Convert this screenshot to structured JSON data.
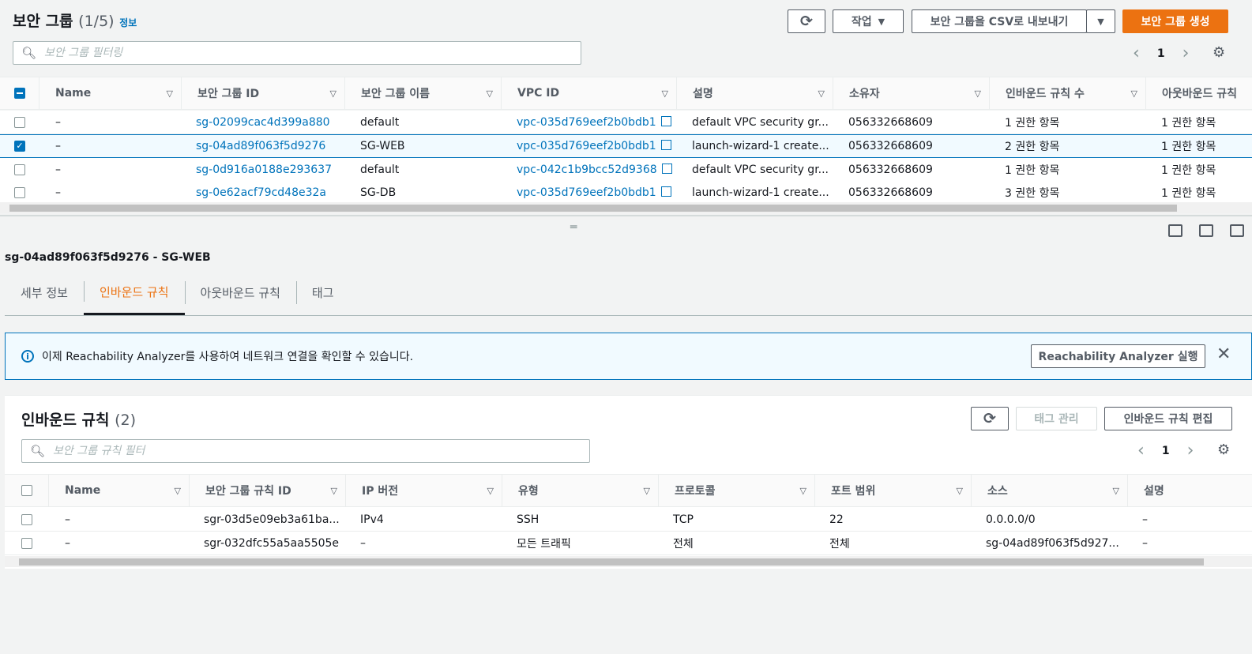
{
  "header": {
    "title": "보안 그룹",
    "count": "(1/5)",
    "info": "정보",
    "actions_label": "작업",
    "export_label": "보안 그룹을 CSV로 내보내기",
    "create_label": "보안 그룹 생성"
  },
  "search": {
    "placeholder": "보안 그룹 필터링"
  },
  "pager": {
    "page": "1"
  },
  "sg_table": {
    "columns": [
      "Name",
      "보안 그룹 ID",
      "보안 그룹 이름",
      "VPC ID",
      "설명",
      "소유자",
      "인바운드 규칙 수",
      "아웃바운드 규칙"
    ],
    "rows": [
      {
        "name": "–",
        "id": "sg-02099cac4d399a880",
        "group_name": "default",
        "vpc": "vpc-035d769eef2b0bdb1",
        "desc": "default VPC security gr...",
        "owner": "056332668609",
        "inbound": "1 권한 항목",
        "outbound": "1 권한 항목",
        "selected": false
      },
      {
        "name": "–",
        "id": "sg-04ad89f063f5d9276",
        "group_name": "SG-WEB",
        "vpc": "vpc-035d769eef2b0bdb1",
        "desc": "launch-wizard-1 create...",
        "owner": "056332668609",
        "inbound": "2 권한 항목",
        "outbound": "1 권한 항목",
        "selected": true
      },
      {
        "name": "–",
        "id": "sg-0d916a0188e293637",
        "group_name": "default",
        "vpc": "vpc-042c1b9bcc52d9368",
        "desc": "default VPC security gr...",
        "owner": "056332668609",
        "inbound": "1 권한 항목",
        "outbound": "1 권한 항목",
        "selected": false
      },
      {
        "name": "–",
        "id": "sg-0e62acf79cd48e32a",
        "group_name": "SG-DB",
        "vpc": "vpc-035d769eef2b0bdb1",
        "desc": "launch-wizard-1 create...",
        "owner": "056332668609",
        "inbound": "3 권한 항목",
        "outbound": "1 권한 항목",
        "selected": false
      }
    ]
  },
  "detail": {
    "heading": "sg-04ad89f063f5d9276 - SG-WEB",
    "tabs": [
      "세부 정보",
      "인바운드 규칙",
      "아웃바운드 규칙",
      "태그"
    ],
    "alert_text": "이제 Reachability Analyzer를 사용하여 네트워크 연결을 확인할 수 있습니다.",
    "alert_button": "Reachability Analyzer 실행"
  },
  "inbound": {
    "title": "인바운드 규칙",
    "count": "(2)",
    "manage_tags": "태그 관리",
    "edit_label": "인바운드 규칙 편집",
    "search_placeholder": "보안 그룹 규칙 필터",
    "page": "1",
    "columns": [
      "Name",
      "보안 그룹 규칙 ID",
      "IP 버전",
      "유형",
      "프로토콜",
      "포트 범위",
      "소스",
      "설명"
    ],
    "rows": [
      {
        "name": "–",
        "rule_id": "sgr-03d5e09eb3a61ba...",
        "ip": "IPv4",
        "type": "SSH",
        "protocol": "TCP",
        "port": "22",
        "source": "0.0.0.0/0",
        "desc": "–"
      },
      {
        "name": "–",
        "rule_id": "sgr-032dfc55a5aa5505e",
        "ip": "–",
        "type": "모든 트래픽",
        "protocol": "전체",
        "port": "전체",
        "source": "sg-04ad89f063f5d927...",
        "desc": "–"
      }
    ]
  }
}
